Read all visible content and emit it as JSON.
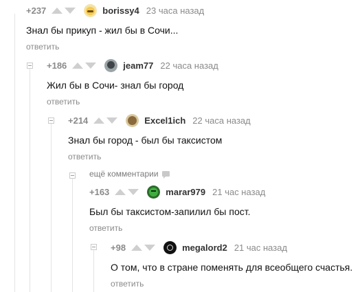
{
  "reply_label": "ответить",
  "more_comments_label": "ещё комментарии",
  "comments": [
    {
      "rating": "+237",
      "user": "borissy4",
      "time": "23 часа назад",
      "text": "Знал бы прикуп - жил бы в Сочи...",
      "reply": "ответить",
      "avatar_icon": "smiling-face-avatar"
    },
    {
      "rating": "+186",
      "user": "jeam77",
      "time": "22 часа назад",
      "text": "Жил бы в Сочи- знал бы город",
      "reply": "ответить",
      "avatar_icon": "dark-portrait-avatar"
    },
    {
      "rating": "+214",
      "user": "Excel1ich",
      "time": "22 часа назад",
      "text": "Знал бы город - был бы таксистом",
      "reply": "ответить",
      "avatar_icon": "brown-portrait-avatar"
    },
    {
      "rating": "+163",
      "user": "marar979",
      "time": "21 час назад",
      "text": "Был бы таксистом-запилил бы пост.",
      "reply": "ответить",
      "avatar_icon": "green-face-avatar"
    },
    {
      "rating": "+98",
      "user": "megalord2",
      "time": "21 час назад",
      "text": "О том, что в стране поменять для всеобщего счастья.",
      "reply": "ответить",
      "avatar_icon": "black-logo-avatar"
    }
  ],
  "colors": {
    "muted": "#8a8a8a",
    "vote_arrow": "#cfcfcf",
    "thread_line": "#e3e3e3"
  }
}
